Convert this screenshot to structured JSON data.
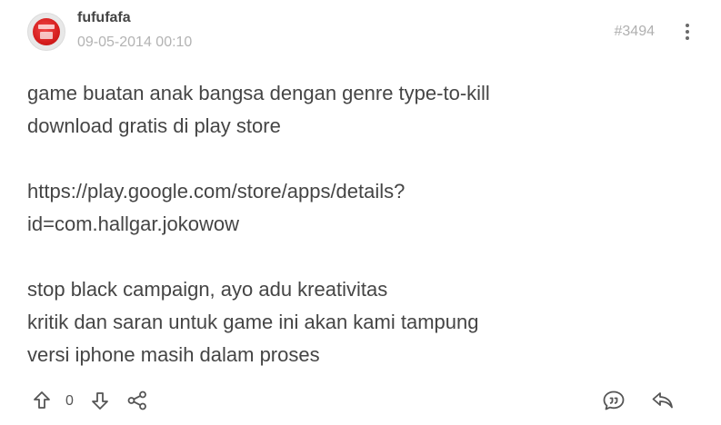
{
  "post": {
    "username": "fufufafa",
    "timestamp": "09-05-2014 00:10",
    "post_number": "#3494",
    "content_lines": [
      "game buatan anak bangsa dengan genre type-to-kill",
      "download gratis di play store",
      "",
      "https://play.google.com/store/apps/details?",
      "id=com.hallgar.jokowow",
      "",
      "stop black campaign, ayo adu kreativitas",
      "kritik dan saran untuk game ini akan kami tampung",
      "versi iphone masih dalam proses"
    ],
    "vote_count": "0"
  },
  "icons": {
    "more": "more-vertical-icon",
    "upvote": "arrow-up-icon",
    "downvote": "arrow-down-icon",
    "share": "share-icon",
    "quote": "quote-icon",
    "reply": "reply-icon"
  },
  "colors": {
    "text": "#454545",
    "muted": "#b3b3b3",
    "icon": "#555555",
    "avatar_red": "#d61e1e"
  }
}
